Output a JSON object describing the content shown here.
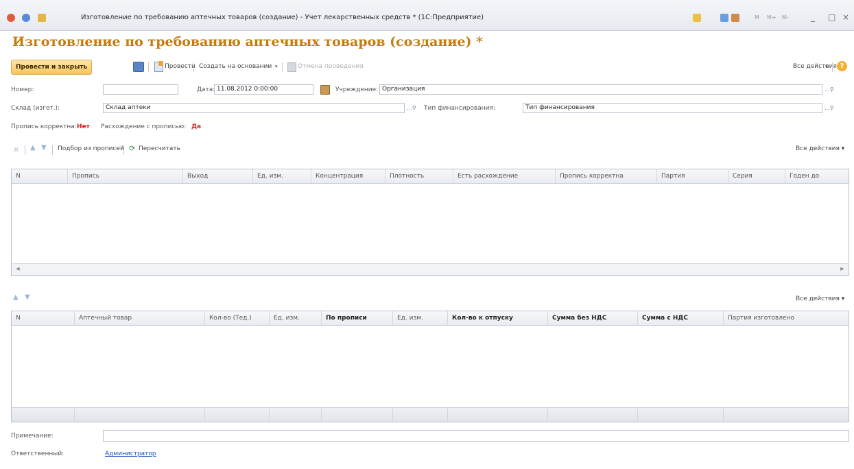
{
  "window": {
    "title": "Изготовление по требованию аптечных товаров (создание) - Учет лекарственных средств * (1С:Предприятие)",
    "buttons": [
      "_",
      "□",
      "×"
    ],
    "small_title_icons": [
      "M",
      "M+",
      "M-"
    ]
  },
  "header": {
    "title": "Изготовление по требованию аптечных товаров (создание) *"
  },
  "toolbar": {
    "post_close": "Провести и закрыть",
    "post": "Провести",
    "create_based": "Создать на основании",
    "cancel_posting": "Отмена проведения",
    "all_actions": "Все действия",
    "help": "?"
  },
  "form": {
    "number_label": "Номер:",
    "number_value": "",
    "date_label": "Дата:",
    "date_value": "11.08.2012 0:00:00",
    "institution_label": "Учреждение:",
    "institution_value": "Организация",
    "warehouse_label": "Склад (изгот.):",
    "warehouse_value": "Склад аптеки",
    "financing_label": "Тип финансирования:",
    "financing_value": "Тип финансирования",
    "picker": "...",
    "recipe_ok_label": "Пропись корректна:",
    "recipe_ok_value": "Нет",
    "discrepancy_label": "Расхождение с прописью:",
    "discrepancy_value": "Да"
  },
  "table1": {
    "toolbar": {
      "pick_from_recipes": "Подбор из прописей",
      "recalculate": "Пересчитать",
      "all_actions": "Все действия"
    },
    "columns": [
      "N",
      "Пропись",
      "Выход",
      "Ед. изм.",
      "Концентрация",
      "Плотность",
      "Есть расхождение",
      "Пропись корректна",
      "Партия",
      "Серия",
      "Годен до"
    ]
  },
  "table2": {
    "toolbar": {
      "all_actions": "Все действия"
    },
    "columns": [
      "N",
      "Аптечный товар",
      "Кол-во (Тед.)",
      "Ед. изм.",
      "По прописи",
      "Ед. изм.",
      "Кол-во к отпуску",
      "Сумма без НДС",
      "Сумма с НДС",
      "Партия изготовлено"
    ]
  },
  "footer": {
    "note_label": "Примечание:",
    "note_value": "",
    "responsible_label": "Ответственный:",
    "responsible_value": "Администратор"
  },
  "colors": {
    "title": "#c47b12",
    "alert": "#e21a1a",
    "link": "#1a4fb5",
    "primary_button": "#f7c65a"
  }
}
